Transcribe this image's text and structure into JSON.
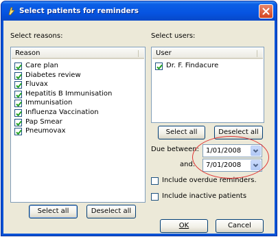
{
  "window": {
    "title": "Select patients for reminders",
    "close_label": "Close"
  },
  "reasons": {
    "label": "Select reasons:",
    "column_header": "Reason",
    "items": [
      {
        "label": "Care plan",
        "checked": true
      },
      {
        "label": "Diabetes review",
        "checked": true
      },
      {
        "label": "Fluvax",
        "checked": true
      },
      {
        "label": "Hepatitis B Immunisation",
        "checked": true
      },
      {
        "label": "Immunisation",
        "checked": true
      },
      {
        "label": "Influenza Vaccination",
        "checked": true
      },
      {
        "label": "Pap Smear",
        "checked": true
      },
      {
        "label": "Pneumovax",
        "checked": true
      }
    ],
    "select_all": "Select all",
    "deselect_all": "Deselect all"
  },
  "users": {
    "label": "Select users:",
    "column_header": "User",
    "items": [
      {
        "label": "Dr. F. Findacure",
        "checked": true
      }
    ],
    "select_all": "Select all",
    "deselect_all": "Deselect all"
  },
  "due": {
    "between_label": "Due between:",
    "and_label": "and:",
    "from_date": "1/01/2008",
    "to_date": "7/01/2008"
  },
  "options": {
    "include_overdue": {
      "label": "Include overdue reminders.",
      "checked": false
    },
    "include_inactive": {
      "label": "Include inactive patients",
      "checked": false
    }
  },
  "footer": {
    "ok": "OK",
    "cancel": "Cancel"
  },
  "colors": {
    "titlebar": "#0654e1",
    "dialog_bg": "#ece9d8",
    "highlight_oval": "#e03030",
    "close_button": "#d3431f"
  }
}
